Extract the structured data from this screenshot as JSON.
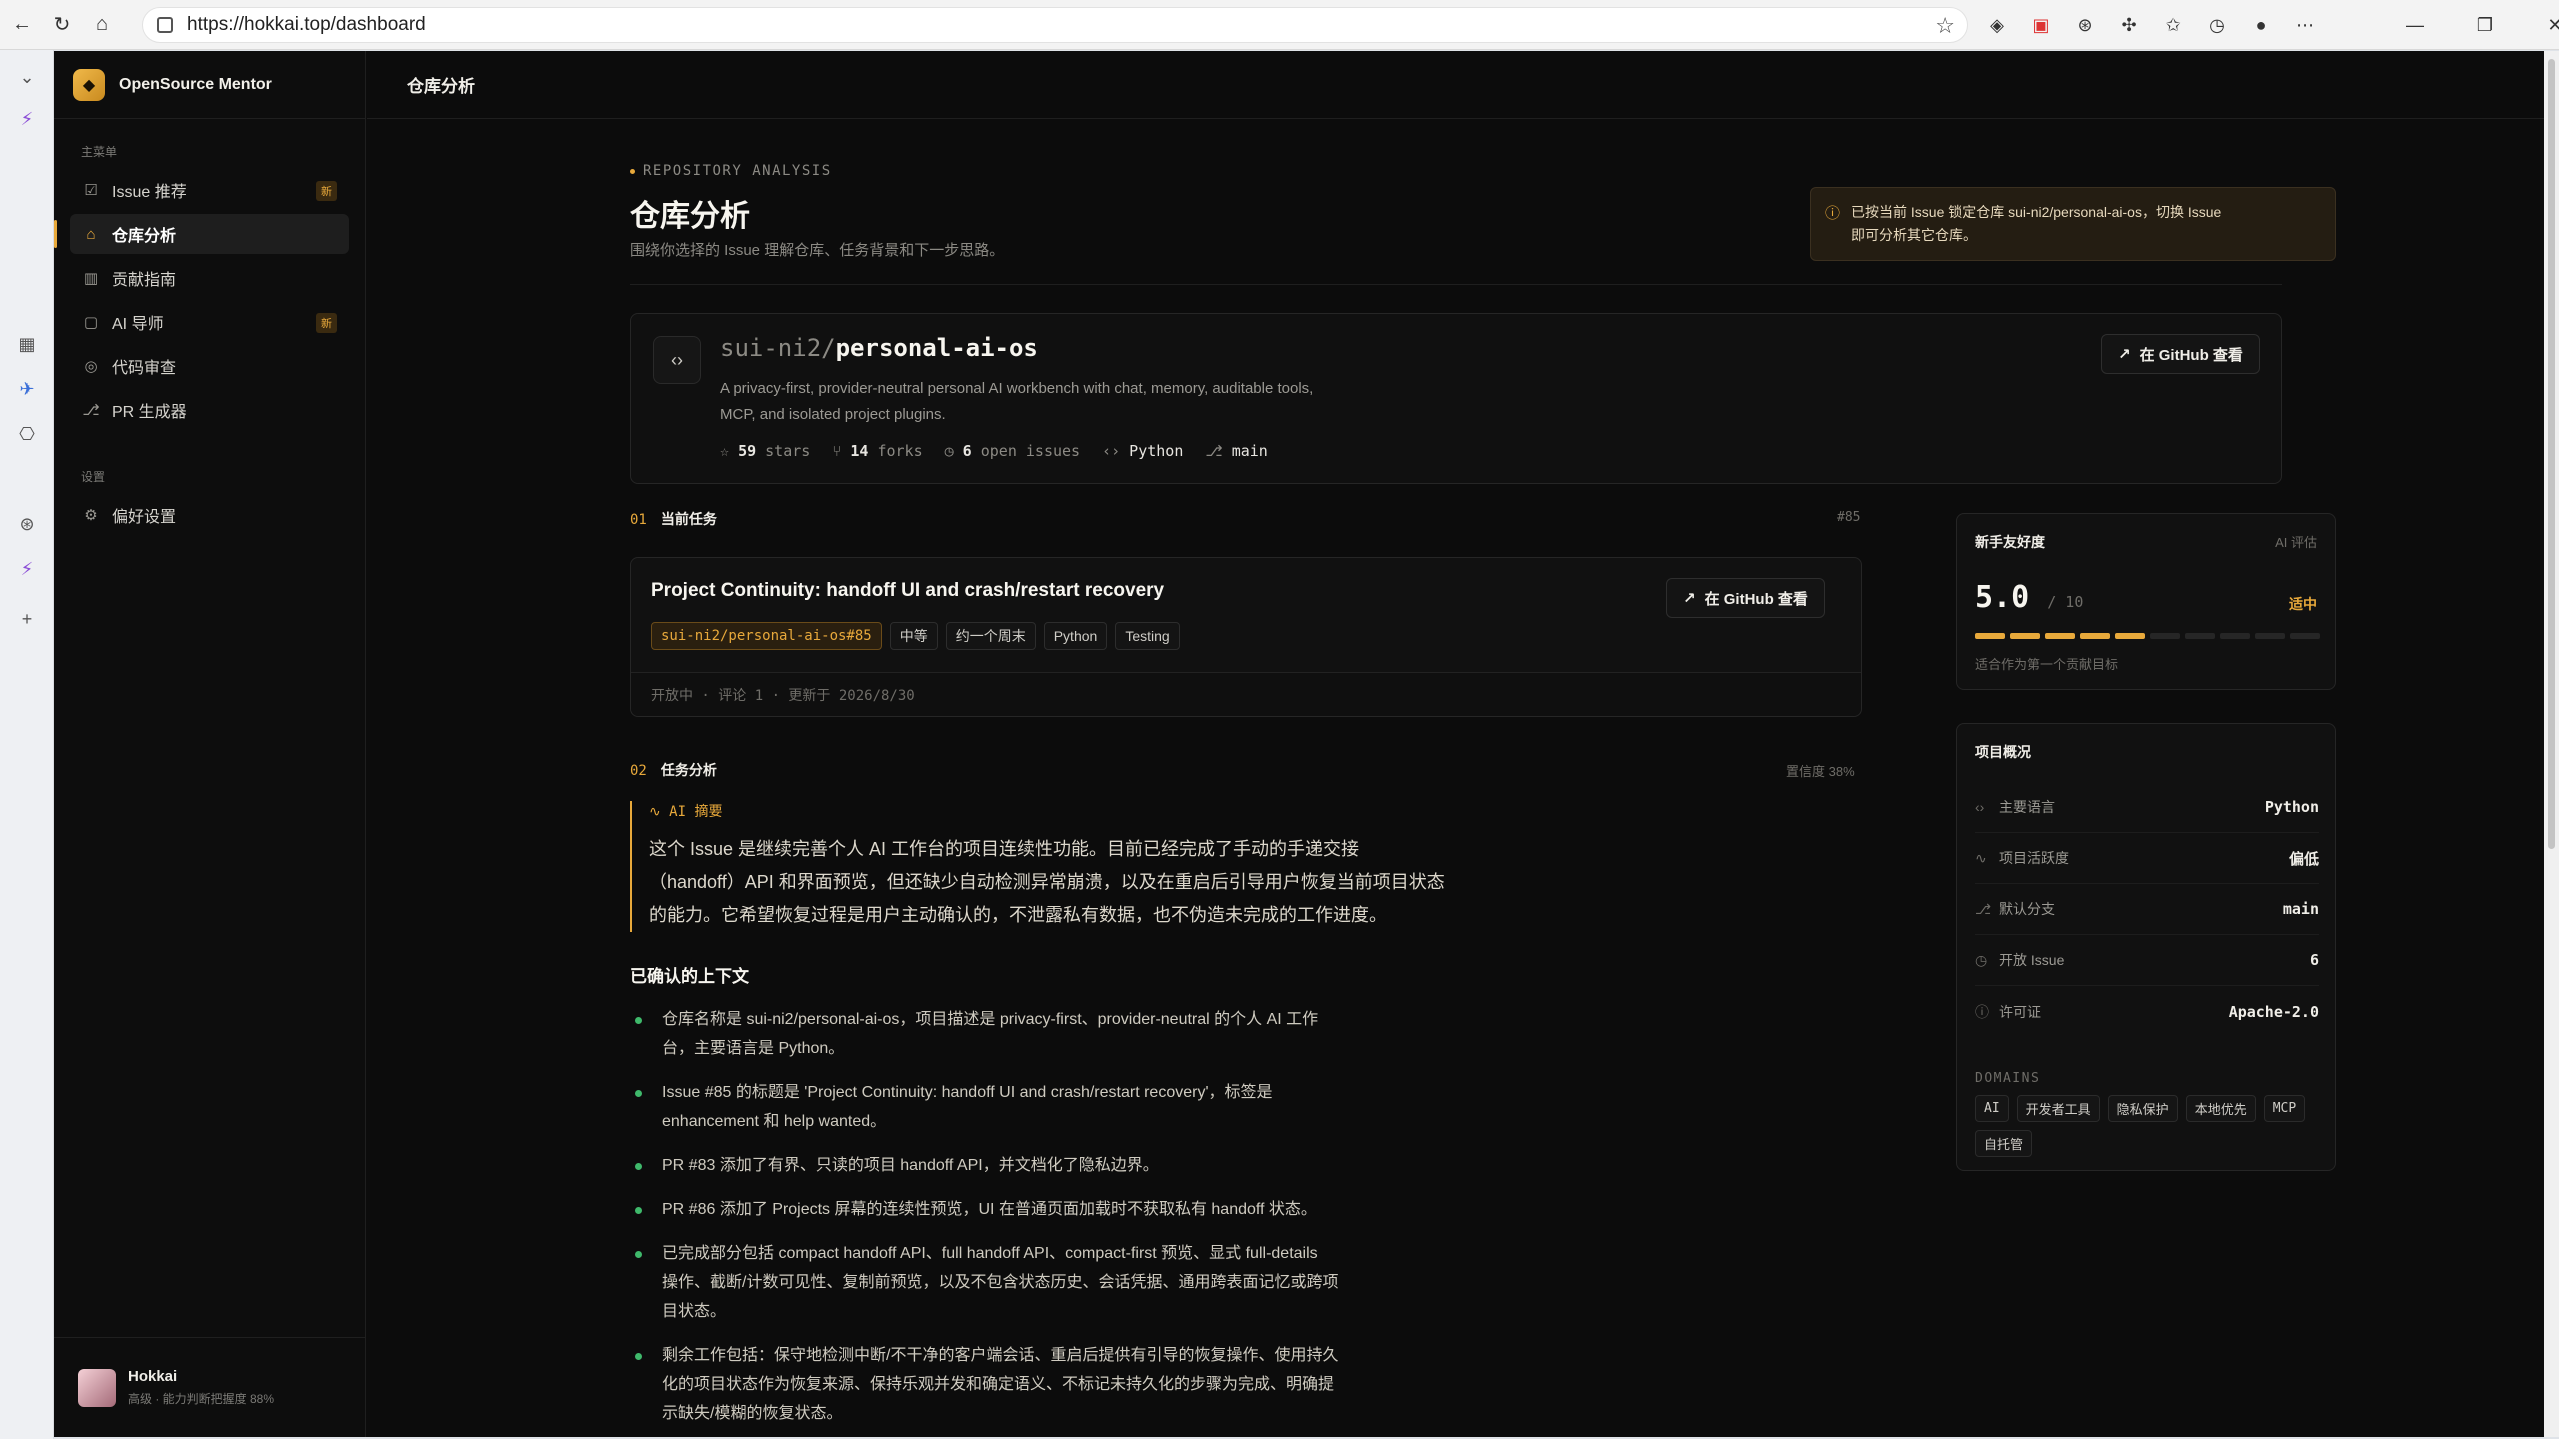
{
  "browser": {
    "url": "https://hokkai.top/dashboard"
  },
  "sidebar": {
    "brand": "OpenSource Mentor",
    "section_main": "主菜单",
    "section_settings": "设置",
    "items": [
      {
        "label": "Issue 推荐",
        "badge": "新"
      },
      {
        "label": "仓库分析"
      },
      {
        "label": "贡献指南"
      },
      {
        "label": "AI 导师",
        "badge": "新"
      },
      {
        "label": "代码审查"
      },
      {
        "label": "PR 生成器"
      }
    ],
    "settings_item": "偏好设置",
    "user": {
      "name": "Hokkai",
      "sub": "高级 · 能力判断把握度 88%"
    }
  },
  "topbar": {
    "title": "仓库分析"
  },
  "page": {
    "eyebrow": "REPOSITORY ANALYSIS",
    "title": "仓库分析",
    "subtitle": "围绕你选择的 Issue 理解仓库、任务背景和下一步思路。",
    "notice_line1": "已按当前 Issue 锁定仓库 sui-ni2/personal-ai-os，切换 Issue",
    "notice_line2": "即可分析其它仓库。"
  },
  "repo": {
    "owner": "sui-ni2/",
    "name": "personal-ai-os",
    "desc_line1": "A privacy-first, provider-neutral personal AI workbench with chat, memory, auditable tools,",
    "desc_line2": "MCP, and isolated project plugins.",
    "stars": "59",
    "stars_label": "stars",
    "forks": "14",
    "forks_label": "forks",
    "issues": "6",
    "issues_label": "open issues",
    "language": "Python",
    "branch": "main",
    "github_btn": "在 GitHub 查看"
  },
  "task_section": {
    "num": "01",
    "title": "当前任务",
    "right": "#85"
  },
  "task": {
    "title": "Project Continuity: handoff UI and crash/restart recovery",
    "tags": [
      "sui-ni2/personal-ai-os#85",
      "中等",
      "约一个周末",
      "Python",
      "Testing"
    ],
    "footer": "开放中 · 评论 1 · 更新于 2026/8/30",
    "github_btn": "在 GitHub 查看"
  },
  "analysis_section": {
    "num": "02",
    "title": "任务分析",
    "right": "置信度 38%"
  },
  "ai_summary": {
    "label": "AI 摘要",
    "line1": "这个 Issue 是继续完善个人 AI 工作台的项目连续性功能。目前已经完成了手动的手递交接",
    "line2": "（handoff）API 和界面预览，但还缺少自动检测异常崩溃，以及在重启后引导用户恢复当前项目状态",
    "line3": "的能力。它希望恢复过程是用户主动确认的，不泄露私有数据，也不伪造未完成的工作进度。"
  },
  "context": {
    "title": "已确认的上下文",
    "items": [
      {
        "l1": "仓库名称是 sui-ni2/personal-ai-os，项目描述是 privacy-first、provider-neutral 的个人 AI 工作",
        "l2": "台，主要语言是 Python。"
      },
      {
        "l1": "Issue #85 的标题是 'Project Continuity: handoff UI and crash/restart recovery'，标签是",
        "l2": "enhancement 和 help wanted。"
      },
      {
        "l1": "PR #83 添加了有界、只读的项目 handoff API，并文档化了隐私边界。",
        "l2": ""
      },
      {
        "l1": "PR #86 添加了 Projects 屏幕的连续性预览，UI 在普通页面加载时不获取私有 handoff 状态。",
        "l2": ""
      },
      {
        "l1": "已完成部分包括 compact handoff API、full handoff API、compact-first 预览、显式 full-details",
        "l2": "操作、截断/计数可见性、复制前预览，以及不包含状态历史、会话凭据、通用跨表面记忆或跨项",
        "l3": "目状态。"
      },
      {
        "l1": "剩余工作包括：保守地检测中断/不干净的客户端会话、重启后提供有引导的恢复操作、使用持久",
        "l2": "化的项目状态作为恢复来源、保持乐观并发和确定语义、不标记未持久化的步骤为完成、明确提",
        "l3": "示缺失/模糊的恢复状态。"
      }
    ]
  },
  "friendliness": {
    "title": "新手友好度",
    "tag": "AI 评估",
    "score": "5.0",
    "max": "/ 10",
    "level": "适中",
    "score_value": 5,
    "note": "适合作为第一个贡献目标"
  },
  "overview": {
    "title": "项目概况",
    "rows": [
      {
        "label": "主要语言",
        "value": "Python"
      },
      {
        "label": "项目活跃度",
        "value": "偏低"
      },
      {
        "label": "默认分支",
        "value": "main"
      },
      {
        "label": "开放 Issue",
        "value": "6"
      },
      {
        "label": "许可证",
        "value": "Apache-2.0"
      }
    ],
    "domains_label": "DOMAINS",
    "domains": [
      "AI",
      "开发者工具",
      "隐私保护",
      "本地优先",
      "MCP",
      "自托管"
    ]
  },
  "colors": {
    "accent": "#e8a93b",
    "bullet": "#3fb96b",
    "bg": "#0c0c0c"
  }
}
